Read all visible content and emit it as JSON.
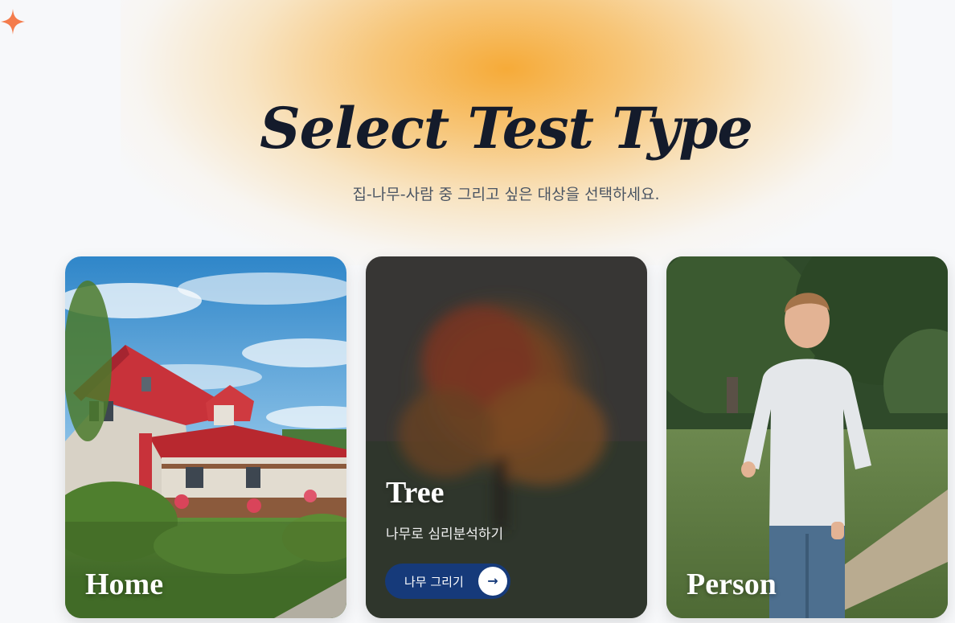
{
  "header": {
    "title": "Select Test Type",
    "subtitle": "집-나무-사람 중 그리고 싶은 대상을 선택하세요."
  },
  "cards": [
    {
      "id": "home",
      "title": "Home"
    },
    {
      "id": "tree",
      "title": "Tree",
      "description": "나무로 심리분석하기",
      "button_label": "나무 그리기",
      "button_icon": "arrow-right-icon"
    },
    {
      "id": "person",
      "title": "Person"
    }
  ],
  "colors": {
    "accent_glow": "#f6a428",
    "sparkle": "#f47c4c",
    "title": "#141b2b",
    "button": "#163a7a"
  },
  "icons": {
    "sparkle": "sparkle-icon"
  }
}
